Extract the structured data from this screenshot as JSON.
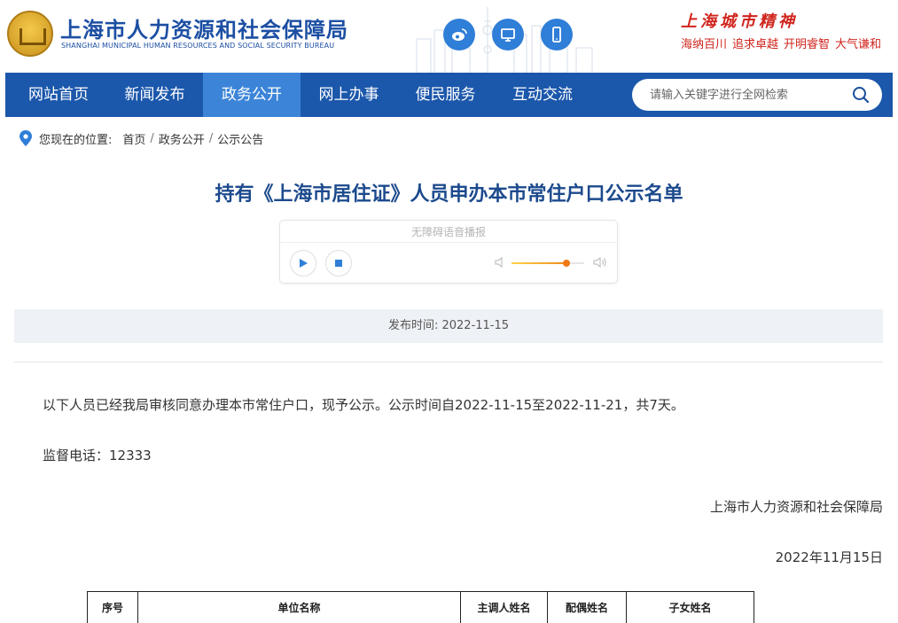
{
  "header": {
    "title": "上海市人力资源和社会保障局",
    "subtitle": "SHANGHAI MUNICIPAL HUMAN RESOURCES AND SOCIAL SECURITY BUREAU",
    "social_icons": [
      "weibo-icon",
      "desktop-icon",
      "mobile-icon"
    ],
    "spirit_title": "上海城市精神",
    "spirit_mottos": [
      "海纳百川",
      "追求卓越",
      "开明睿智",
      "大气谦和"
    ]
  },
  "nav": {
    "items": [
      {
        "label": "网站首页",
        "active": false
      },
      {
        "label": "新闻发布",
        "active": false
      },
      {
        "label": "政务公开",
        "active": true
      },
      {
        "label": "网上办事",
        "active": false
      },
      {
        "label": "便民服务",
        "active": false
      },
      {
        "label": "互动交流",
        "active": false
      }
    ],
    "search_placeholder": "请输入关键字进行全网检索"
  },
  "breadcrumb": {
    "lead": "您现在的位置:",
    "items": [
      "首页",
      "政务公开",
      "公示公告"
    ]
  },
  "article": {
    "title": "持有《上海市居住证》人员申办本市常住户口公示名单",
    "player_label": "无障碍语音播报",
    "volume_level": 0.75,
    "publish_label": "发布时间:",
    "publish_date": "2022-11-15",
    "paragraphs": [
      "以下人员已经我局审核同意办理本市常住户口，现予公示。公示时间自2022-11-15至2022-11-21，共7天。",
      "监督电话：12333"
    ],
    "signature": "上海市人力资源和社会保障局",
    "date_line": "2022年11月15日"
  },
  "table": {
    "headers": [
      "序号",
      "单位名称",
      "主调人姓名",
      "配偶姓名",
      "子女姓名"
    ]
  },
  "colors": {
    "brand_blue": "#1b57ab",
    "nav_active": "#3c84d8",
    "title_blue": "#1c4a8d",
    "spirit_red": "#d0241d",
    "volume_orange": "#f07a14"
  }
}
